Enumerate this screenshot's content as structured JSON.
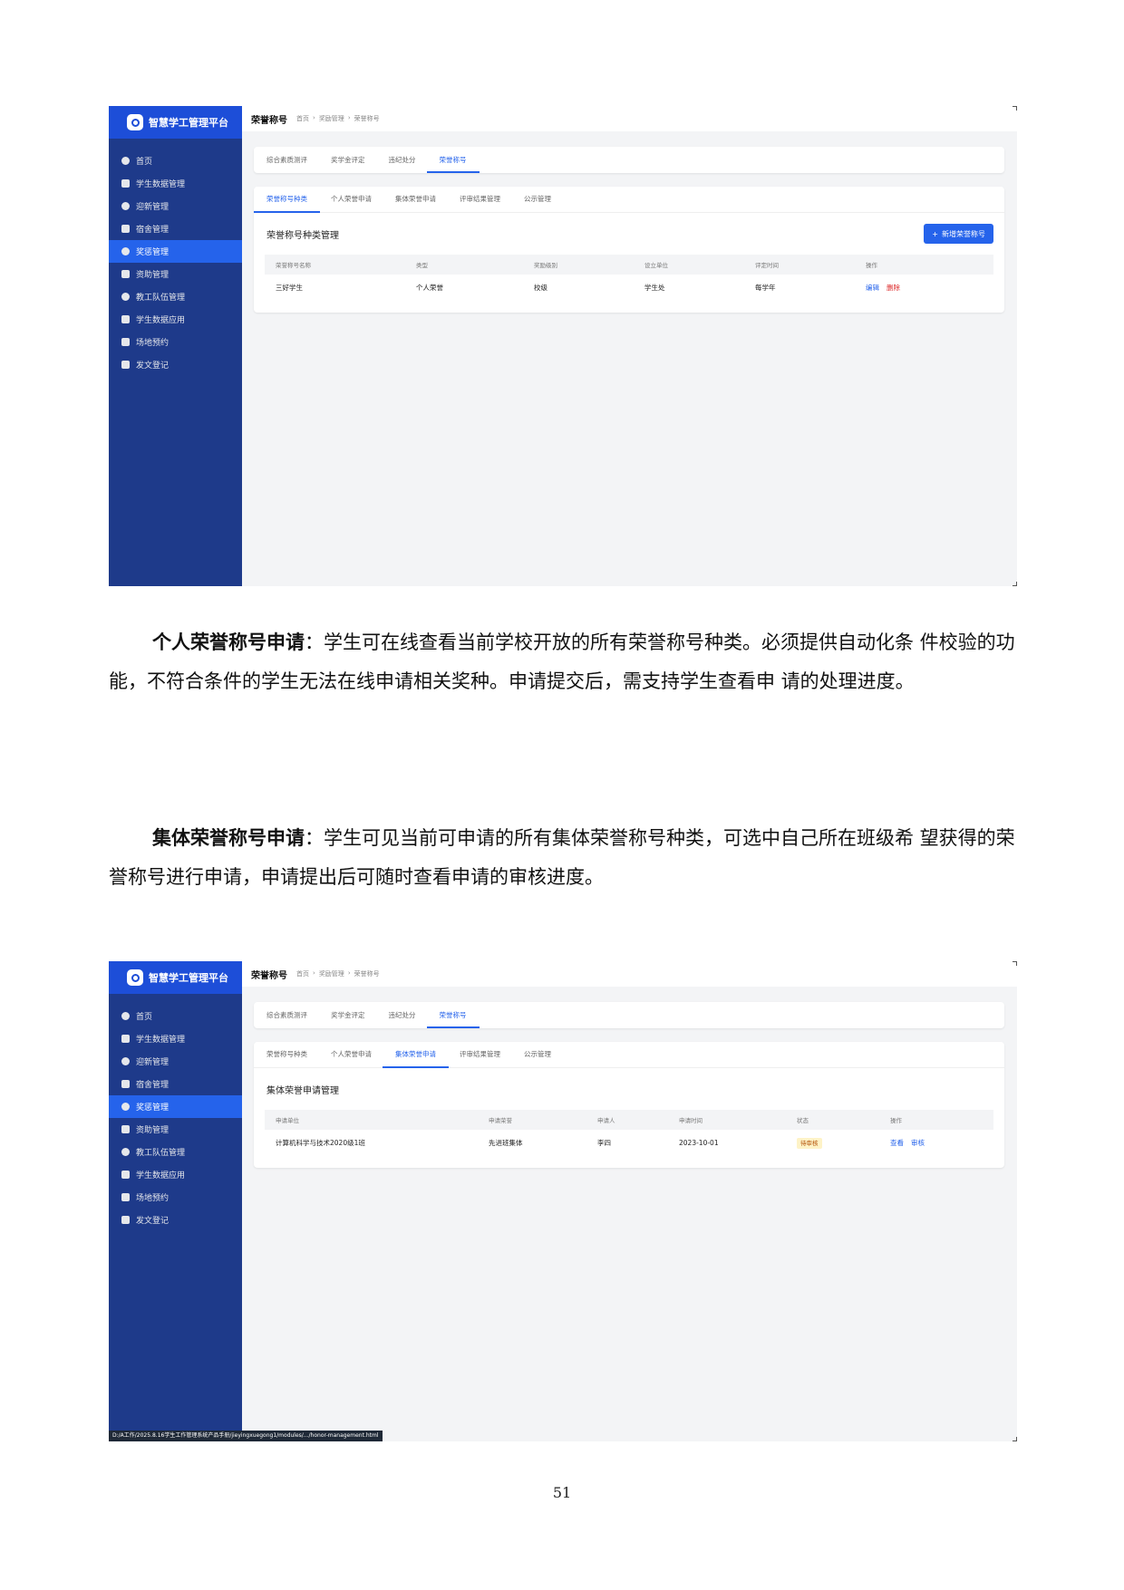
{
  "app": {
    "brand": "智慧学工管理平台",
    "page_title": "荣誉称号",
    "breadcrumb": [
      "首页",
      "奖励管理",
      "荣誉称号"
    ],
    "menu": [
      {
        "label": "首页",
        "icon": "dashboard-icon"
      },
      {
        "label": "学生数据管理",
        "icon": "graduation-icon"
      },
      {
        "label": "迎新管理",
        "icon": "user-add-icon"
      },
      {
        "label": "宿舍管理",
        "icon": "building-icon"
      },
      {
        "label": "奖惩管理",
        "icon": "award-icon",
        "active": true
      },
      {
        "label": "资助管理",
        "icon": "hand-coin-icon"
      },
      {
        "label": "教工队伍管理",
        "icon": "users-icon"
      },
      {
        "label": "学生数据应用",
        "icon": "chart-line-icon"
      },
      {
        "label": "场地预约",
        "icon": "calendar-icon"
      },
      {
        "label": "发文登记",
        "icon": "file-icon"
      }
    ],
    "tabs": [
      "综合素质测评",
      "奖学金评定",
      "违纪处分",
      "荣誉称号"
    ],
    "subtabs": [
      "荣誉称号种类",
      "个人荣誉申请",
      "集体荣誉申请",
      "评审结果管理",
      "公示管理"
    ]
  },
  "screen1": {
    "section_title": "荣誉称号种类管理",
    "new_button": "新增荣誉称号",
    "headers": [
      "荣誉称号名称",
      "类型",
      "奖励级别",
      "设立单位",
      "评定时间",
      "操作"
    ],
    "rows": [
      {
        "name": "三好学生",
        "type": "个人荣誉",
        "level": "校级",
        "unit": "学生处",
        "time": "每学年",
        "edit": "编辑",
        "delete": "删除"
      }
    ]
  },
  "paragraph1": {
    "lead": "个人荣誉称号申请",
    "text": "：学生可在线查看当前学校开放的所有荣誉称号种类。必须提供自动化条 件校验的功能，不符合条件的学生无法在线申请相关奖种。申请提交后，需支持学生查看申 请的处理进度。"
  },
  "paragraph2": {
    "lead": "集体荣誉称号申请",
    "text": "：学生可见当前可申请的所有集体荣誉称号种类，可选中自己所在班级希 望获得的荣誉称号进行申请，申请提出后可随时查看申请的审核进度。"
  },
  "screen2": {
    "section_title": "集体荣誉申请管理",
    "headers": [
      "申请单位",
      "申请荣誉",
      "申请人",
      "申请时间",
      "状态",
      "操作"
    ],
    "rows": [
      {
        "unit": "计算机科学与技术2020级1班",
        "honor": "先进班集体",
        "applicant": "李四",
        "date": "2023-10-01",
        "status": "待审核",
        "view": "查看",
        "review": "审核"
      }
    ],
    "status_url": "D:/A工作/2025.8.16学生工作管理系统产品手册/jieyingxuegong1/modules/.../honor-management.html"
  },
  "page_number": "51",
  "colors": {
    "sidebar": "#1e3a8a",
    "accent": "#2563eb",
    "danger": "#dc2626",
    "pending": "#b45309"
  }
}
